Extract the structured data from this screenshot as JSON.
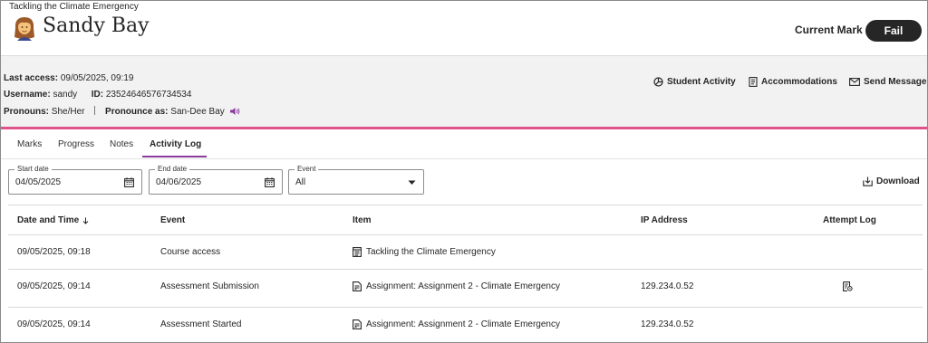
{
  "header": {
    "course_title": "Tackling the Climate Emergency",
    "student_name": "Sandy Bay",
    "current_mark_label": "Current Mark",
    "current_mark_value": "Fail"
  },
  "student_info": {
    "last_access_label": "Last access:",
    "last_access_value": "09/05/2025, 09:19",
    "username_label": "Username:",
    "username_value": "sandy",
    "id_label": "ID:",
    "id_value": "23524646576734534",
    "pronouns_label": "Pronouns:",
    "pronouns_value": "She/Her",
    "pronounce_label": "Pronounce as:",
    "pronounce_value": "San-Dee Bay"
  },
  "actions": {
    "student_activity": "Student Activity",
    "accommodations": "Accommodations",
    "send_message": "Send Message"
  },
  "tabs": [
    {
      "label": "Marks"
    },
    {
      "label": "Progress"
    },
    {
      "label": "Notes"
    },
    {
      "label": "Activity Log"
    }
  ],
  "filters": {
    "start_date_label": "Start date",
    "start_date_value": "04/05/2025",
    "end_date_label": "End date",
    "end_date_value": "04/06/2025",
    "event_label": "Event",
    "event_value": "All"
  },
  "download_label": "Download",
  "table": {
    "columns": [
      "Date and Time",
      "Event",
      "Item",
      "IP Address",
      "Attempt Log"
    ],
    "rows": [
      {
        "date": "09/05/2025, 09:18",
        "event": "Course access",
        "item": "Tackling the Climate Emergency",
        "item_icon": "course-icon",
        "ip": "",
        "attempt_log": false
      },
      {
        "date": "09/05/2025, 09:14",
        "event": "Assessment Submission",
        "item": "Assignment: Assignment 2 - Climate Emergency",
        "item_icon": "assignment-icon",
        "ip": "129.234.0.52",
        "attempt_log": true
      },
      {
        "date": "09/05/2025, 09:14",
        "event": "Assessment Started",
        "item": "Assignment: Assignment 2 - Climate Emergency",
        "item_icon": "assignment-icon",
        "ip": "129.234.0.52",
        "attempt_log": false
      }
    ]
  },
  "colors": {
    "accent_pink": "#e0538a",
    "tab_underline": "#8a3a9c",
    "mark_pill": "#262626",
    "speaker": "#8a3a9c"
  }
}
